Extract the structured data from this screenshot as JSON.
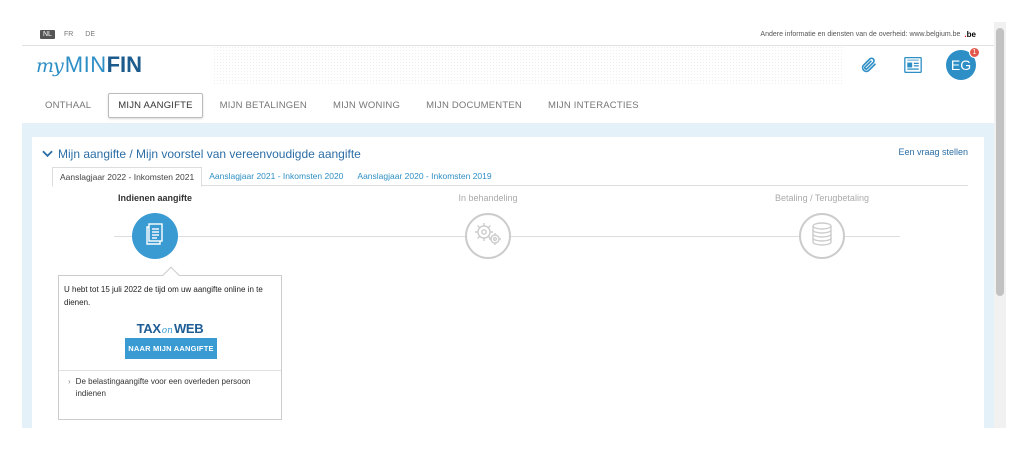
{
  "languages": [
    {
      "label": "NL",
      "active": true
    },
    {
      "label": "FR",
      "active": false
    },
    {
      "label": "DE",
      "active": false
    }
  ],
  "gov_info": {
    "text": "Andere informatie en diensten van de overheid: www.belgium.be",
    "be_logo_main": "be",
    "be_logo_dot": "."
  },
  "logo": {
    "my": "my",
    "min": "MIN",
    "fin": "FIN"
  },
  "header": {
    "icons": [
      "paperclip-icon",
      "news-icon"
    ],
    "avatar_initials": "EG",
    "notification_count": "1"
  },
  "nav": {
    "items": [
      {
        "label": "ONTHAAL",
        "active": false
      },
      {
        "label": "MIJN AANGIFTE",
        "active": true
      },
      {
        "label": "MIJN BETALINGEN",
        "active": false
      },
      {
        "label": "MIJN WONING",
        "active": false
      },
      {
        "label": "MIJN DOCUMENTEN",
        "active": false
      },
      {
        "label": "MIJN INTERACTIES",
        "active": false
      }
    ]
  },
  "main": {
    "title": "Mijn aangifte / Mijn voorstel van vereenvoudigde aangifte",
    "ask_link": "Een vraag stellen",
    "tabs": [
      {
        "label": "Aanslagjaar 2022 - Inkomsten 2021",
        "active": true
      },
      {
        "label": "Aanslagjaar 2021 - Inkomsten 2020",
        "active": false
      },
      {
        "label": "Aanslagjaar 2020 - Inkomsten 2019",
        "active": false
      }
    ],
    "steps": [
      {
        "label": "Indienen aangifte",
        "icon": "document-icon",
        "active": true
      },
      {
        "label": "In behandeling",
        "icon": "gears-icon",
        "active": false
      },
      {
        "label": "Betaling / Terugbetaling",
        "icon": "coins-icon",
        "active": false
      }
    ],
    "popover": {
      "text": "U hebt tot 15 juli 2022 de tijd om uw aangifte online in te dienen.",
      "taxonweb_tax": "TAX",
      "taxonweb_on": "on",
      "taxonweb_web": "WEB",
      "button_label": "NAAR MIJN AANGIFTE",
      "link_label": "De belastingaangifte voor een overleden persoon indienen"
    }
  },
  "colors": {
    "accent": "#3a9bd3",
    "brand_dark": "#1d5b8d",
    "band_bg": "#e5f1f9",
    "badge": "#e4584b"
  }
}
